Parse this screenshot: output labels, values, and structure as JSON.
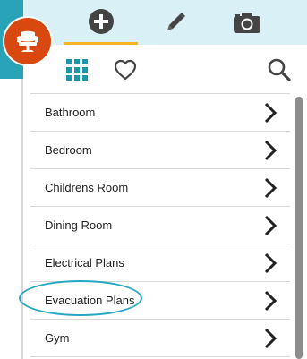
{
  "top_tabs": [
    {
      "name": "add",
      "icon": "plus-circle-icon",
      "active": true
    },
    {
      "name": "edit",
      "icon": "pencil-icon",
      "active": false
    },
    {
      "name": "camera",
      "icon": "camera-icon",
      "active": false
    }
  ],
  "logo": {
    "icon": "chair-icon",
    "color": "#d9480f"
  },
  "toolbar": {
    "grid_icon": "grid-icon",
    "favorites_icon": "heart-icon",
    "search_icon": "search-icon"
  },
  "categories": [
    {
      "label": "Bathroom"
    },
    {
      "label": "Bedroom"
    },
    {
      "label": "Childrens Room"
    },
    {
      "label": "Dining Room"
    },
    {
      "label": "Electrical Plans"
    },
    {
      "label": "Evacuation Plans",
      "highlighted": true
    },
    {
      "label": "Gym"
    }
  ],
  "colors": {
    "accent_teal": "#29a3b8",
    "tab_active_underline": "#f6b326",
    "topbar_bg": "#d9f1f6",
    "highlight_ring": "#27a6c3"
  }
}
